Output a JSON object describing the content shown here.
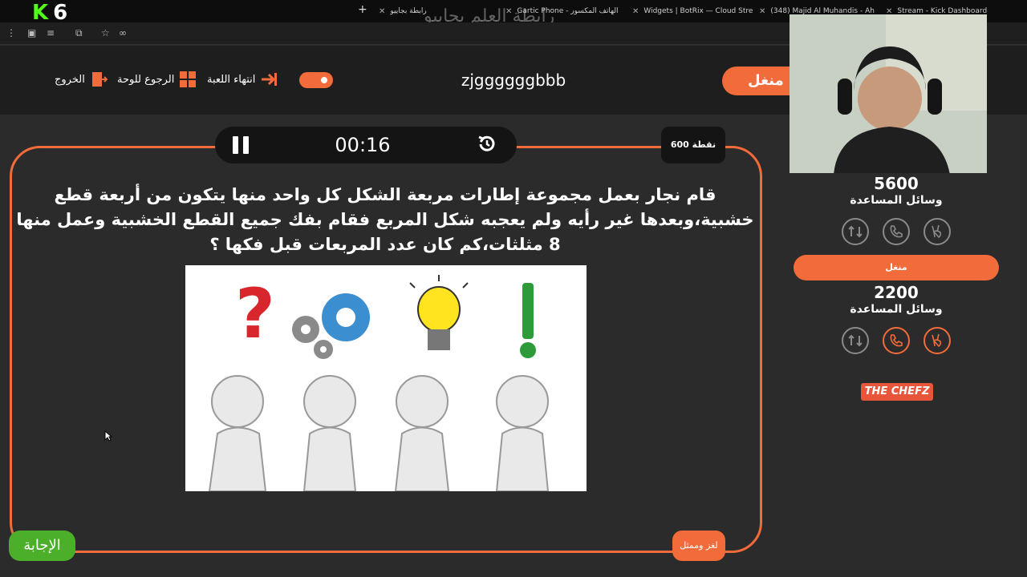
{
  "browser": {
    "tabs": [
      {
        "label": "رابطة بجاييو",
        "x": 0
      },
      {
        "label": "Gartic Phone - الهاتف المكسور",
        "x": 0
      },
      {
        "label": "Widgets | BotRix — Cloud Stream",
        "x": 0
      },
      {
        "label": "(348) Majid Al Muhandis - Ah",
        "x": 0
      },
      {
        "label": "Stream - Kick Dashboard",
        "x": 0
      }
    ],
    "logo_letter": "K",
    "logo_number": "6",
    "watermark": "رابطة العلم بجاييو",
    "new_tab": "+"
  },
  "header": {
    "exit_label": "الخروج",
    "board_label": "الرجوع للوحة",
    "end_game_label": "انتهاء اللعبة",
    "game_title": "zjggggggbbb",
    "team1_name": "منغل"
  },
  "timer": {
    "time": "00:16"
  },
  "points": "600 نقطة",
  "question": "قام نجار بعمل مجموعة إطارات مربعة الشكل كل واحد منها يتكون من أربعة قطع خشبية،وبعدها غير رأيه ولم يعجبه شكل المربع فقام بفك جميع القطع الخشبية وعمل منها 8 مثلثات،كم كان عدد المربعات قبل فكها ؟",
  "answer_button": "الإجابة",
  "category_button": "لغز وممثل",
  "team1": {
    "score": "5600",
    "aids_label": "وسائل المساعدة"
  },
  "team2": {
    "name": "منغل",
    "score": "2200",
    "aids_label": "وسائل المساعدة"
  },
  "sponsor": "THE CHEFZ",
  "colors": {
    "accent": "#f26b3a",
    "answer": "#4caf2a",
    "background": "#2b2b2b"
  }
}
